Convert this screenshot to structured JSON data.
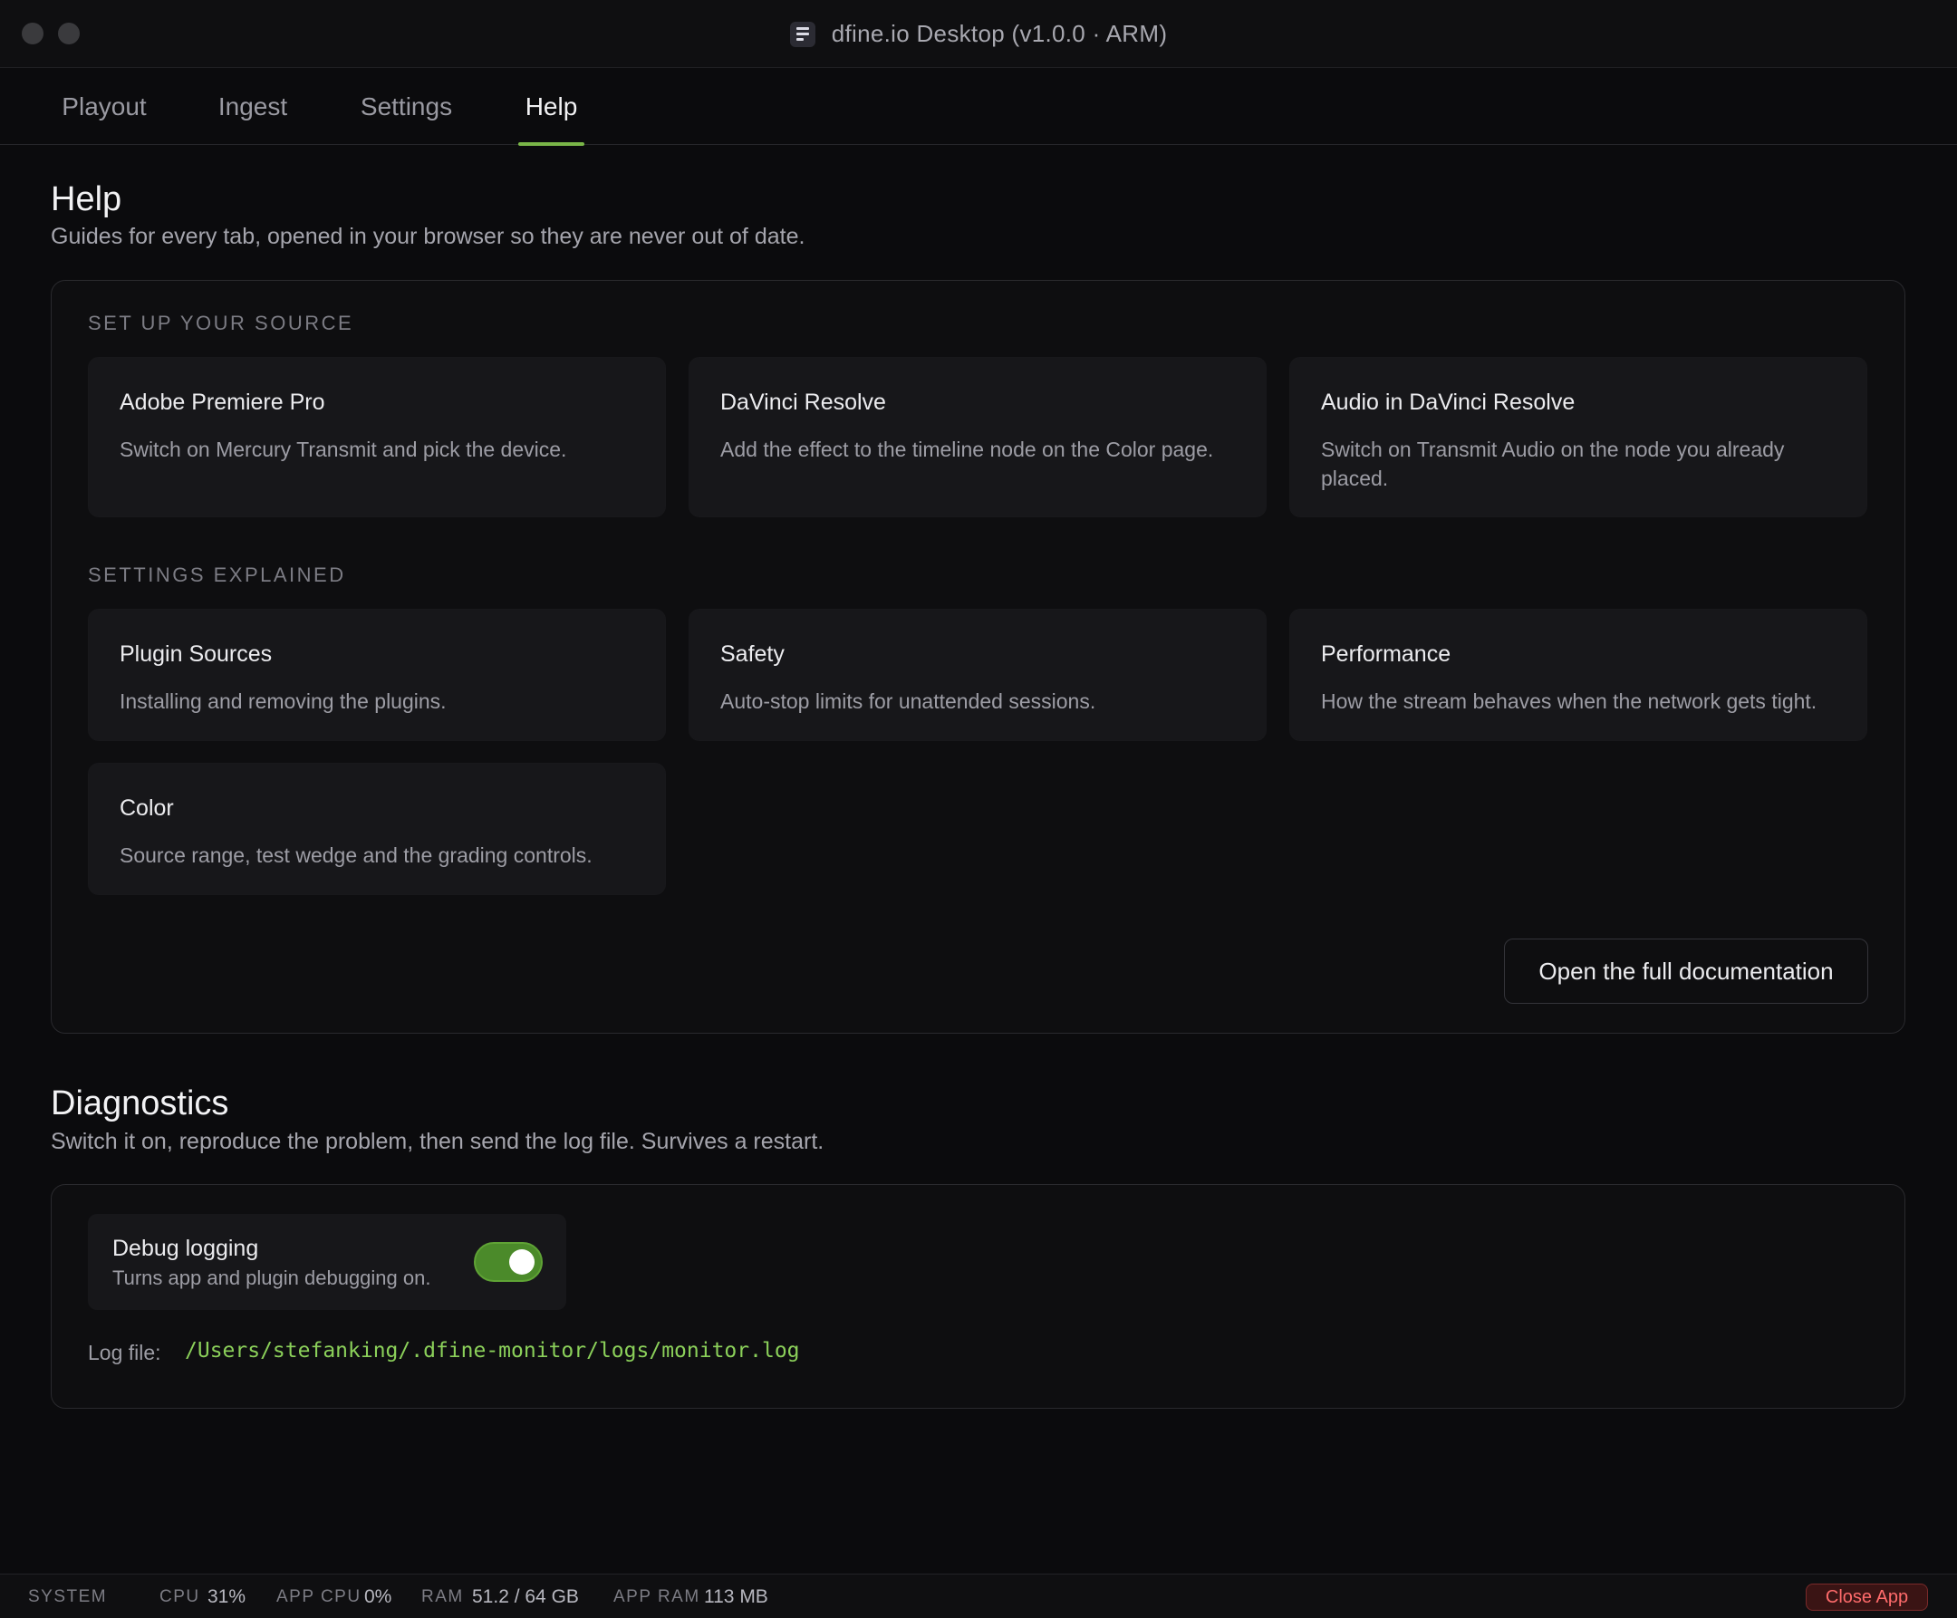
{
  "window": {
    "title": "dfine.io Desktop (v1.0.0 · ARM)"
  },
  "tabs": [
    {
      "label": "Playout"
    },
    {
      "label": "Ingest"
    },
    {
      "label": "Settings"
    },
    {
      "label": "Help",
      "active": true
    }
  ],
  "help": {
    "title": "Help",
    "subtitle": "Guides for every tab, opened in your browser so they are never out of date.",
    "groups": [
      {
        "label": "SET UP YOUR SOURCE",
        "cards": [
          {
            "title": "Adobe Premiere Pro",
            "desc": "Switch on Mercury Transmit and pick the device."
          },
          {
            "title": "DaVinci Resolve",
            "desc": "Add the effect to the timeline node on the Color page."
          },
          {
            "title": "Audio in DaVinci Resolve",
            "desc": "Switch on Transmit Audio on the node you already placed."
          }
        ]
      },
      {
        "label": "SETTINGS EXPLAINED",
        "cards": [
          {
            "title": "Plugin Sources",
            "desc": "Installing and removing the plugins."
          },
          {
            "title": "Safety",
            "desc": "Auto-stop limits for unattended sessions."
          },
          {
            "title": "Performance",
            "desc": "How the stream behaves when the network gets tight."
          },
          {
            "title": "Color",
            "desc": "Source range, test wedge and the grading controls."
          }
        ]
      }
    ],
    "docs_button": "Open the full documentation"
  },
  "diagnostics": {
    "title": "Diagnostics",
    "subtitle": "Switch it on, reproduce the problem, then send the log file. Survives a restart.",
    "debug_title": "Debug logging",
    "debug_desc": "Turns app and plugin debugging on.",
    "debug_enabled": true,
    "log_label": "Log file:",
    "log_path": "/Users/stefanking/.dfine-monitor/logs/monitor.log"
  },
  "status": {
    "system_label": "SYSTEM",
    "cpu_label": "CPU",
    "cpu_value": "31%",
    "app_cpu_label": "APP CPU",
    "app_cpu_value": "0%",
    "ram_label": "RAM",
    "ram_value": "51.2 / 64 GB",
    "app_ram_label": "APP RAM",
    "app_ram_value": "113 MB",
    "close_label": "Close App"
  },
  "colors": {
    "accent": "#7ab648",
    "toggle_on": "#4b8a2a",
    "log_path": "#8bd05a",
    "danger": "#ff6b6b"
  },
  "icons": [
    "app-logo-icon"
  ]
}
